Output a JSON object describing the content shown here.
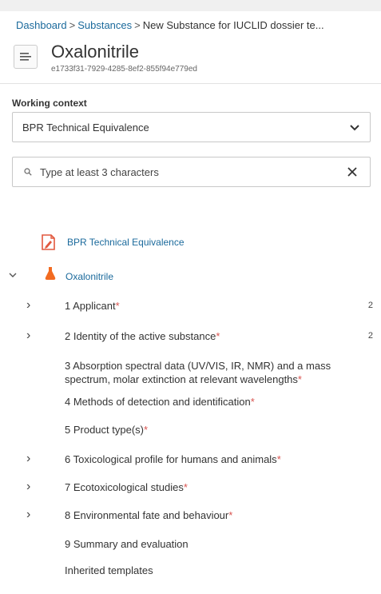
{
  "breadcrumb": {
    "items": [
      "Dashboard",
      "Substances",
      "New Substance for IUCLID dossier te..."
    ],
    "separator": ">"
  },
  "header": {
    "title": "Oxalonitrile",
    "uuid": "e1733f31-7929-4285-8ef2-855f94e779ed"
  },
  "working_context": {
    "label": "Working context",
    "selected": "BPR Technical Equivalence"
  },
  "search": {
    "placeholder": "Type at least 3 characters"
  },
  "tree": {
    "template_label": "BPR Technical Equivalence",
    "substance_label": "Oxalonitrile",
    "nodes": [
      {
        "label": "1 Applicant",
        "required": "*",
        "count": "2",
        "expandable": true
      },
      {
        "label": "2 Identity of the active substance",
        "required": "*",
        "count": "2",
        "expandable": true
      },
      {
        "label": "3 Absorption spectral data (UV/VIS, IR, NMR) and a mass spectrum, molar extinction at relevant wavelengths",
        "required": "*",
        "count": "",
        "expandable": false
      },
      {
        "label": "4 Methods of detection and identification",
        "required": "*",
        "count": "",
        "expandable": false
      },
      {
        "label": "5 Product type(s)",
        "required": "*",
        "count": "",
        "expandable": false
      },
      {
        "label": "6 Toxicological profile for humans and animals",
        "required": "*",
        "count": "",
        "expandable": true
      },
      {
        "label": "7 Ecotoxicological studies",
        "required": "*",
        "count": "",
        "expandable": true
      },
      {
        "label": "8 Environmental fate and behaviour",
        "required": "*",
        "count": "",
        "expandable": true
      },
      {
        "label": "9 Summary and evaluation",
        "required": "",
        "count": "",
        "expandable": false
      },
      {
        "label": "Inherited templates",
        "required": "",
        "count": "",
        "expandable": false
      }
    ]
  },
  "colors": {
    "link": "#1b6a9c",
    "required": "#d9534f",
    "flask": "#f26b21",
    "template_icon": "#e2583e"
  },
  "icons": {
    "menu": "menu-lines-icon",
    "dropdown": "chevron-down-icon",
    "search": "search-icon",
    "clear": "close-icon",
    "template": "document-edit-icon",
    "substance": "flask-icon",
    "expand": "chevron-right-icon",
    "collapse": "chevron-down-icon"
  }
}
